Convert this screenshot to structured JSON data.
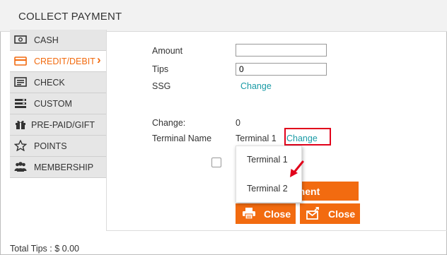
{
  "header": {
    "title": "COLLECT PAYMENT"
  },
  "sidebar": {
    "items": [
      {
        "label": "CASH",
        "icon": "cash-icon"
      },
      {
        "label": "CREDIT/DEBIT",
        "icon": "credit-card-icon",
        "active": true,
        "chevron": "›"
      },
      {
        "label": "CHECK",
        "icon": "check-icon"
      },
      {
        "label": "CUSTOM",
        "icon": "custom-icon"
      },
      {
        "label": "PRE-PAID/GIFT",
        "icon": "gift-icon"
      },
      {
        "label": "POINTS",
        "icon": "star-icon"
      },
      {
        "label": "MEMBERSHIP",
        "icon": "membership-icon"
      }
    ]
  },
  "form": {
    "amount_label": "Amount",
    "amount_value": "",
    "tips_label": "Tips",
    "tips_value": "0",
    "ssg_label": "SSG",
    "ssg_link": "Change",
    "change_label": "Change:",
    "change_value": "0",
    "terminal_label": "Terminal Name",
    "terminal_value": "Terminal 1",
    "terminal_link": "Change"
  },
  "dropdown": {
    "items": [
      "Terminal 1",
      "Terminal 2"
    ]
  },
  "buttons": {
    "pay_partial": "yment",
    "close_print": "Close",
    "close_email": "Close"
  },
  "footer": {
    "total_tips": "Total Tips : $ 0.00"
  },
  "colors": {
    "accent": "#f26b10",
    "link": "#1a9ba6",
    "highlight": "#e1001a"
  }
}
